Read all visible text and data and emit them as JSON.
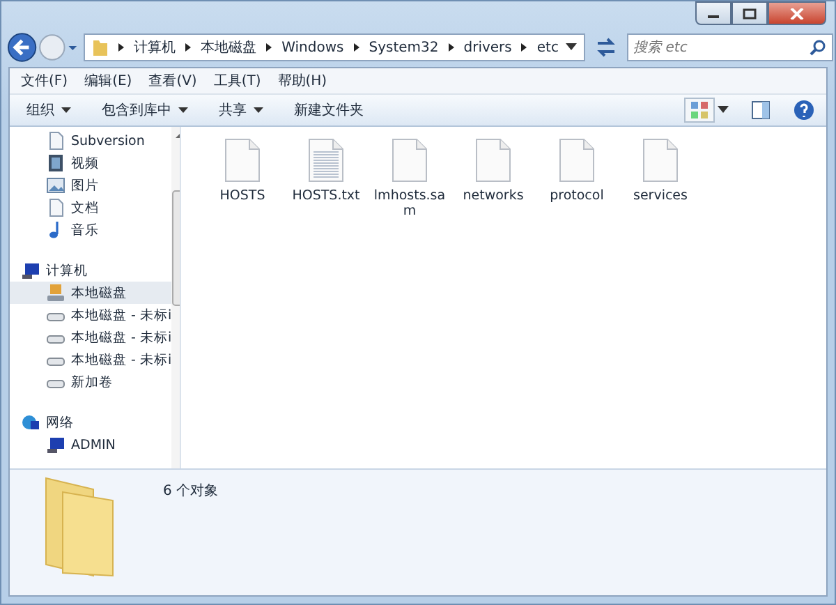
{
  "address": {
    "crumbs": [
      "计算机",
      "本地磁盘",
      "Windows",
      "System32",
      "drivers",
      "etc"
    ]
  },
  "search": {
    "placeholder": "搜索 etc"
  },
  "menu": [
    "文件(F)",
    "编辑(E)",
    "查看(V)",
    "工具(T)",
    "帮助(H)"
  ],
  "toolbar": [
    {
      "label": "组织",
      "dropdown": true
    },
    {
      "label": "包含到库中",
      "dropdown": true
    },
    {
      "label": "共享",
      "dropdown": true
    },
    {
      "label": "新建文件夹",
      "dropdown": false
    }
  ],
  "sidebar": {
    "items": [
      {
        "label": "Subversion",
        "kind": "doc",
        "selected": false
      },
      {
        "label": "视频",
        "kind": "video",
        "selected": false
      },
      {
        "label": "图片",
        "kind": "picture",
        "selected": false
      },
      {
        "label": "文档",
        "kind": "doc",
        "selected": false
      },
      {
        "label": "音乐",
        "kind": "music",
        "selected": false
      },
      {
        "label": "计算机",
        "kind": "computer",
        "selected": false,
        "children": [
          {
            "label": "本地磁盘",
            "kind": "sysdrive",
            "selected": true
          },
          {
            "label": "本地磁盘 - 未标i",
            "kind": "drive",
            "selected": false
          },
          {
            "label": "本地磁盘 - 未标i",
            "kind": "drive",
            "selected": false
          },
          {
            "label": "本地磁盘 - 未标i",
            "kind": "drive",
            "selected": false
          },
          {
            "label": "新加卷",
            "kind": "drive",
            "selected": false
          }
        ]
      },
      {
        "label": "网络",
        "kind": "network",
        "selected": false,
        "children": [
          {
            "label": "ADMIN",
            "kind": "computer",
            "selected": false
          }
        ]
      }
    ]
  },
  "files": [
    {
      "name": "HOSTS",
      "kind": "blank"
    },
    {
      "name": "HOSTS.txt",
      "kind": "text"
    },
    {
      "name": "lmhosts.sam",
      "kind": "blank"
    },
    {
      "name": "networks",
      "kind": "blank"
    },
    {
      "name": "protocol",
      "kind": "blank"
    },
    {
      "name": "services",
      "kind": "blank"
    }
  ],
  "details": {
    "count": "6 个对象"
  }
}
